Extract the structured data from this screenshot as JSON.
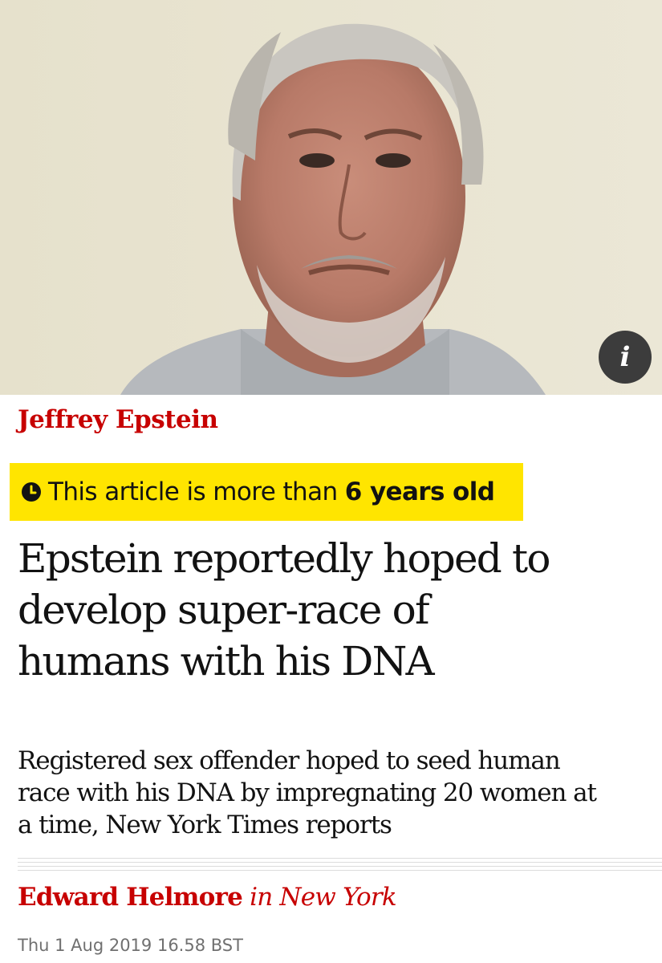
{
  "hero": {
    "image_icon": "portrait-photo",
    "info_glyph": "i"
  },
  "article": {
    "kicker": "Jeffrey Epstein",
    "age_warning": {
      "icon": "clock-icon",
      "prefix": "This article is more than ",
      "age": "6 years old"
    },
    "headline": [
      "Epstein reportedly hoped to",
      "develop super-race of",
      "humans with his DNA"
    ],
    "standfirst": [
      "Registered sex offender hoped to seed human",
      "race with his DNA by impregnating 20 women at",
      "a time, New York Times reports"
    ],
    "byline": {
      "author": "Edward Helmore",
      "location": "in New York"
    },
    "date": "Thu 1 Aug 2019 16.58 BST"
  },
  "colors": {
    "kicker": "#c70000",
    "warning_bg": "#ffe500",
    "text": "#121212",
    "muted": "#707070"
  }
}
